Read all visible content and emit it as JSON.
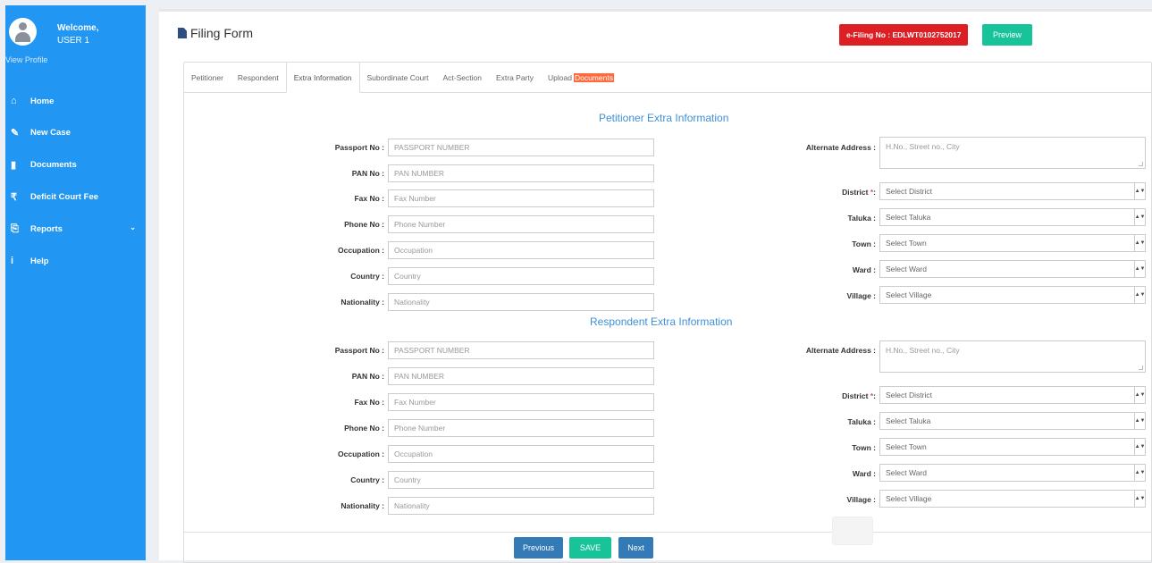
{
  "sidebar": {
    "welcome": "Welcome,",
    "user": "USER 1",
    "view_profile": "View Profile",
    "items": [
      {
        "label": "Home",
        "icon": "home-icon"
      },
      {
        "label": "New Case",
        "icon": "edit-icon"
      },
      {
        "label": "Documents",
        "icon": "document-icon"
      },
      {
        "label": "Deficit Court Fee",
        "icon": "rupee-icon"
      },
      {
        "label": "Reports",
        "icon": "reports-icon"
      },
      {
        "label": "Help",
        "icon": "info-icon"
      }
    ]
  },
  "header": {
    "title": "Filing Form",
    "efiling": "e-Filing No : EDLWT0102752017",
    "preview": "Preview"
  },
  "tabs": [
    {
      "label": "Petitioner"
    },
    {
      "label": "Respondent"
    },
    {
      "label": "Extra Information"
    },
    {
      "label": "Subordinate Court"
    },
    {
      "label": "Act-Section"
    },
    {
      "label": "Extra Party"
    },
    {
      "label": "Upload",
      "highlight": "Documents"
    }
  ],
  "petitioner": {
    "title": "Petitioner Extra Information",
    "fields": [
      {
        "label": "Passport No :",
        "placeholder": "PASSPORT NUMBER"
      },
      {
        "label": "PAN No :",
        "placeholder": "PAN NUMBER"
      },
      {
        "label": "Fax No :",
        "placeholder": "Fax Number"
      },
      {
        "label": "Phone No :",
        "placeholder": "Phone Number"
      },
      {
        "label": "Occupation :",
        "placeholder": "Occupation"
      },
      {
        "label": "Country :",
        "placeholder": "Country"
      },
      {
        "label": "Nationality :",
        "placeholder": "Nationality"
      }
    ],
    "alternate_label": "Alternate Address :",
    "alternate_placeholder": "H.No., Street no., City",
    "selects": [
      {
        "label": "District",
        "required": "*",
        "colon": ":",
        "value": "Select District"
      },
      {
        "label": "Taluka :",
        "value": "Select Taluka"
      },
      {
        "label": "Town :",
        "value": "Select Town"
      },
      {
        "label": "Ward :",
        "value": "Select Ward"
      },
      {
        "label": "Village :",
        "value": "Select Village"
      }
    ]
  },
  "respondent": {
    "title": "Respondent Extra Information",
    "fields": [
      {
        "label": "Passport No :",
        "placeholder": "PASSPORT NUMBER"
      },
      {
        "label": "PAN No :",
        "placeholder": "PAN NUMBER"
      },
      {
        "label": "Fax No :",
        "placeholder": "Fax Number"
      },
      {
        "label": "Phone No :",
        "placeholder": "Phone Number"
      },
      {
        "label": "Occupation :",
        "placeholder": "Occupation"
      },
      {
        "label": "Country :",
        "placeholder": "Country"
      },
      {
        "label": "Nationality :",
        "placeholder": "Nationality"
      }
    ],
    "alternate_label": "Alternate Address :",
    "alternate_placeholder": "H.No., Street no., City",
    "selects": [
      {
        "label": "District",
        "required": "*",
        "colon": ":",
        "value": "Select District"
      },
      {
        "label": "Taluka :",
        "value": "Select Taluka"
      },
      {
        "label": "Town :",
        "value": "Select Town"
      },
      {
        "label": "Ward :",
        "value": "Select Ward"
      },
      {
        "label": "Village :",
        "value": "Select Village"
      }
    ]
  },
  "footer": {
    "previous": "Previous",
    "save": "SAVE",
    "next": "Next"
  },
  "colors": {
    "sidebar": "#2196f3",
    "efiling": "#dd1e23",
    "accent_green": "#19c39a",
    "button_blue": "#337ab7",
    "section_title": "#3f8fd9"
  }
}
